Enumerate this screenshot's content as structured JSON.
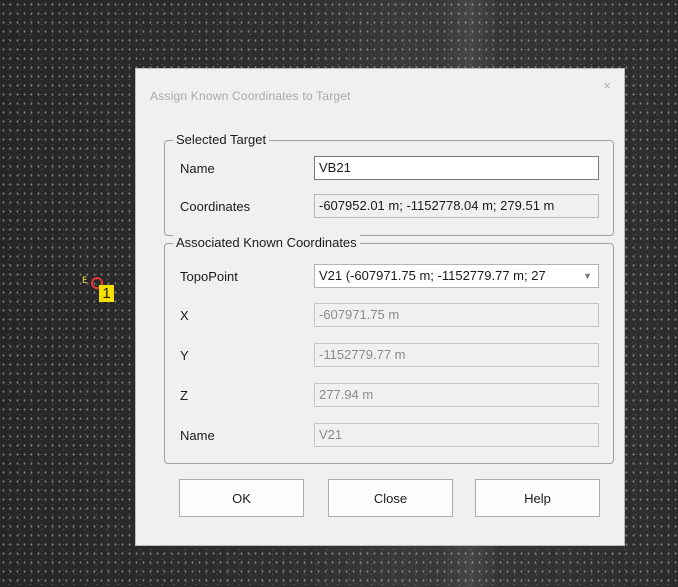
{
  "dialog": {
    "title": "Assign Known Coordinates to Target",
    "close_glyph": "×"
  },
  "target_marker": {
    "letter": "E",
    "number": "1",
    "ring_color": "#e53935",
    "badge_color": "#f5e000"
  },
  "selected_target": {
    "legend": "Selected Target",
    "name_label": "Name",
    "name_value": "VB21",
    "coordinates_label": "Coordinates",
    "coordinates_value": "-607952.01 m; -1152778.04 m; 279.51 m"
  },
  "known_coordinates": {
    "legend": "Associated Known Coordinates",
    "topopoint_label": "TopoPoint",
    "topopoint_value": "V21 (-607971.75 m; -1152779.77 m; 27",
    "x_label": "X",
    "x_value": "-607971.75 m",
    "y_label": "Y",
    "y_value": "-1152779.77 m",
    "z_label": "Z",
    "z_value": "277.94 m",
    "name_label": "Name",
    "name_value": "V21"
  },
  "buttons": {
    "ok": "OK",
    "close": "Close",
    "help": "Help"
  },
  "icons": {
    "close": "close-icon",
    "dropdown": "chevron-down-icon"
  }
}
